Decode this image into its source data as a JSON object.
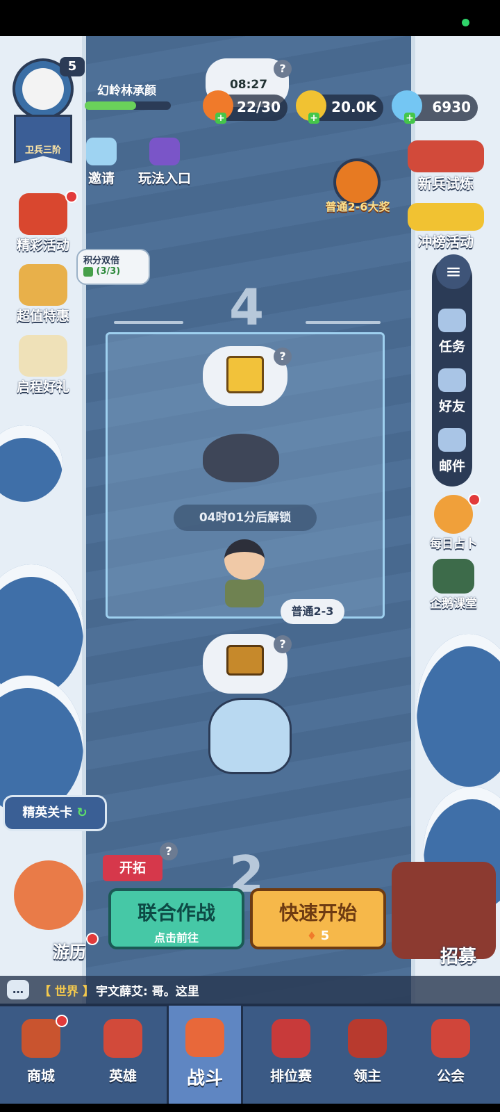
{
  "player": {
    "level": "5",
    "name": "幻岭林承颜",
    "rank": "卫兵三阶",
    "xp_fraction": 0.6
  },
  "resources": {
    "stamina": "22/30",
    "gold": "20.0K",
    "gems": "6930"
  },
  "chest_timer": "08:27",
  "top_actions": {
    "invite": "邀请",
    "gameplay_entry": "玩法入口"
  },
  "left_menu": {
    "events": "精彩活动",
    "deals": "超值特惠",
    "starter_gift": "启程好礼",
    "points_double_title": "积分双倍",
    "points_double_count": "(3/3)"
  },
  "right_menu": {
    "recruit_trial": "新兵试炼",
    "rank_event": "冲榜活动",
    "tasks": "任务",
    "friends": "好友",
    "mail": "邮件",
    "daily_fortune": "每日占卜",
    "penguin_class": "企鹅课堂"
  },
  "grand_prize": "普通2-6大奖",
  "stage": {
    "number_upper": "4",
    "unlock_text": "04时01分后解锁",
    "current_tag": "普通2-3",
    "number_lower": "2"
  },
  "elite_stage": "精英关卡",
  "explore_tag": "开拓",
  "travel": "游历",
  "coop": {
    "title": "联合作战",
    "subtitle": "点击前往"
  },
  "quick_start": {
    "title": "快速开始",
    "cost": "5"
  },
  "recruit": "招募",
  "chat": {
    "channel": "【 世界 】",
    "message": "宇文薛艾: 哥。这里"
  },
  "nav": [
    {
      "label": "商城"
    },
    {
      "label": "英雄"
    },
    {
      "label": "战斗"
    },
    {
      "label": "排位赛"
    },
    {
      "label": "领主"
    },
    {
      "label": "公会"
    }
  ],
  "colors": {
    "accent_green": "#46c8a6",
    "accent_orange": "#f6b84a",
    "nav_bg": "#3b5a85",
    "notify_red": "#e23b3b"
  }
}
